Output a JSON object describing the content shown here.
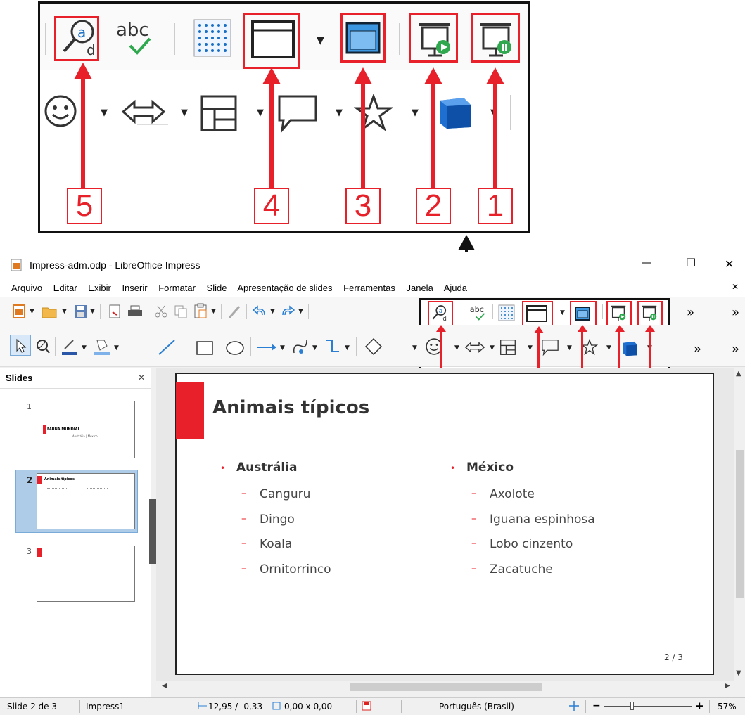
{
  "window": {
    "title": "Impress-adm.odp - LibreOffice Impress",
    "min": "—",
    "max": "☐",
    "close": "✕",
    "doc_close": "✕"
  },
  "menu": [
    "Arquivo",
    "Editar",
    "Exibir",
    "Inserir",
    "Formatar",
    "Slide",
    "Apresentação de slides",
    "Ferramentas",
    "Janela",
    "Ajuda"
  ],
  "toolbar": {
    "overflow": "»",
    "overflow2": "»"
  },
  "callouts": {
    "n1": "1",
    "n2": "2",
    "n3": "3",
    "n4": "4",
    "n5": "5"
  },
  "panel": {
    "title": "Slides",
    "close": "✕",
    "slides": [
      {
        "num": "1",
        "title": "FAUNA MUNDIAL",
        "sub": "Austrália | México"
      },
      {
        "num": "2",
        "title": "Animais típicos"
      },
      {
        "num": "3"
      }
    ]
  },
  "slide": {
    "title": "Animais típicos",
    "page": "2 / 3",
    "col1": {
      "head": "Austrália",
      "items": [
        "Canguru",
        "Dingo",
        "Koala",
        "Ornitorrinco"
      ]
    },
    "col2": {
      "head": "México",
      "items": [
        "Axolote",
        "Iguana espinhosa",
        "Lobo cinzento",
        "Zacatuche"
      ]
    }
  },
  "status": {
    "slide": "Slide 2 de 3",
    "master": "Impress1",
    "pos": "12,95 / -0,33",
    "size": "0,00 x 0,00",
    "lang": "Português (Brasil)",
    "zoom": "57%",
    "zoom_minus": "−",
    "zoom_plus": "+"
  },
  "colors": {
    "accent": "#e8202a",
    "blue": "#2a7fd4"
  }
}
